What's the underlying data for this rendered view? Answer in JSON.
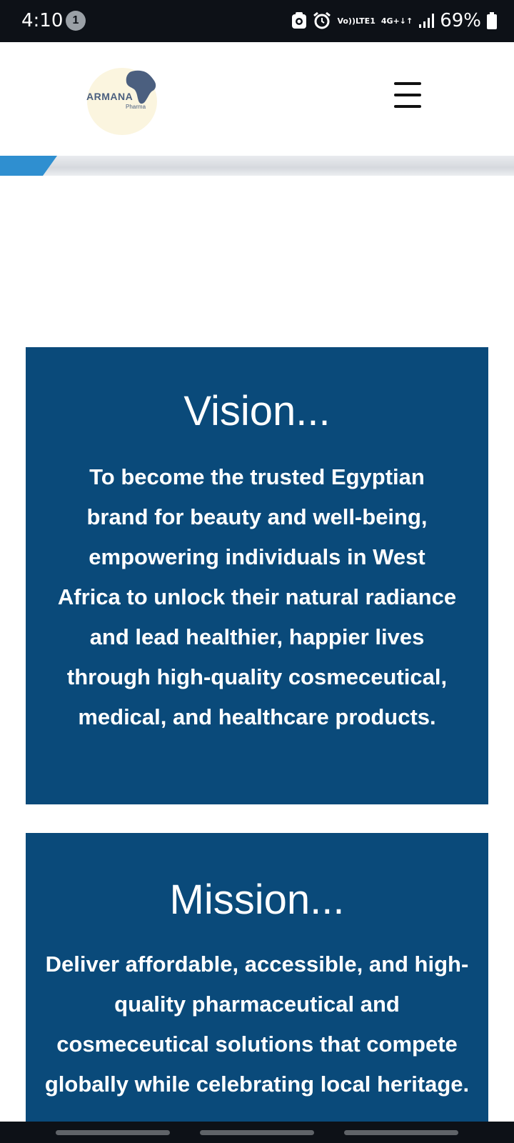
{
  "status_bar": {
    "time": "4:10",
    "notification_count": "1",
    "network_top": "Vo))",
    "network_bottom": "LTE1",
    "data_top": "4G+",
    "data_bottom": "↓↑",
    "battery": "69%"
  },
  "header": {
    "logo_text": "ARMANA",
    "logo_subtext": "Pharma"
  },
  "vision": {
    "title": "Vision...",
    "body": "To become the trusted Egyptian brand for beauty and well-being, empowering individuals in West Africa to unlock their natural radiance and lead healthier, happier lives through high-quality cosmeceutical, medical, and healthcare products."
  },
  "mission": {
    "title": "Mission...",
    "body": "Deliver affordable, accessible, and high-quality pharmaceutical and cosmeceutical solutions that compete globally while celebrating local heritage."
  },
  "colors": {
    "card_bg": "#0a4a7a",
    "status_bg": "#0d1117",
    "logo_accent": "#4b5f7f"
  }
}
